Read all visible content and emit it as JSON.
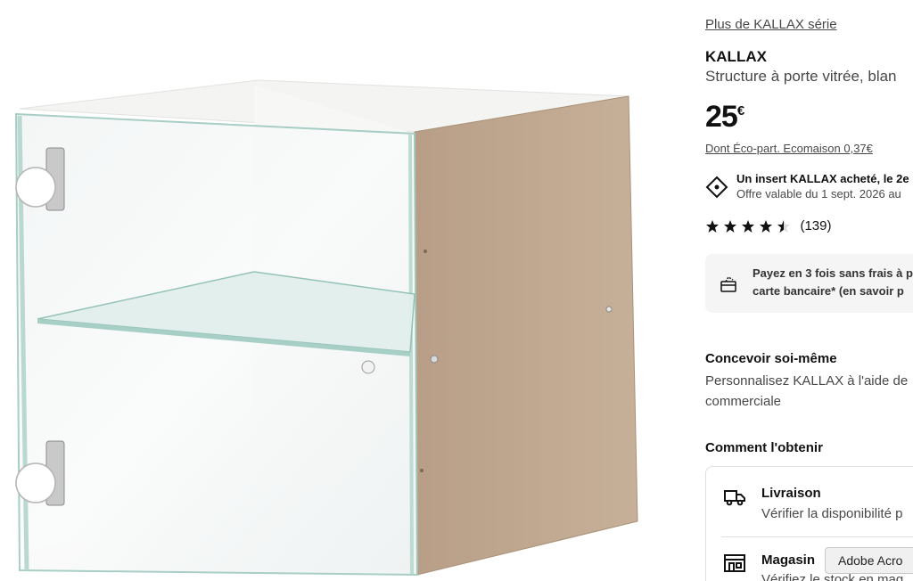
{
  "product_image": {
    "alt": ""
  },
  "panel": {
    "series_link": "Plus de KALLAX série",
    "name": "KALLAX",
    "description": "Structure à porte vitrée, blan",
    "price": {
      "amount": "25",
      "currency": "€"
    },
    "eco_part": "Dont Éco-part. Ecomaison 0,37€",
    "offer": {
      "title": "Un insert KALLAX acheté, le 2e",
      "subtitle": "Offre valable du 1 sept. 2026 au",
      "icon": "price-tag-icon"
    },
    "rating": {
      "value": 4.5,
      "max": 5,
      "count": "(139)"
    },
    "payment": {
      "line1": "Payez en 3 fois sans frais à p",
      "line2": "carte bancaire* (en savoir p",
      "icon": "card-installments-icon"
    },
    "design": {
      "title": "Concevoir soi-même",
      "line1": "Personnalisez KALLAX à l'aide de",
      "line2": "commerciale"
    },
    "obtain": {
      "title": "Comment l'obtenir",
      "delivery": {
        "title": "Livraison",
        "text": "Vérifier la disponibilité p",
        "icon": "truck-icon"
      },
      "store": {
        "title": "Magasin",
        "text": "Vérifiez le stock en mag",
        "icon": "store-icon"
      }
    }
  },
  "tooltip": {
    "label": "Adobe Acro"
  },
  "colors": {
    "accent_text": "#111111",
    "muted_text": "#484848",
    "panel_bg": "#f5f5f5",
    "board": "#c4ab93"
  }
}
